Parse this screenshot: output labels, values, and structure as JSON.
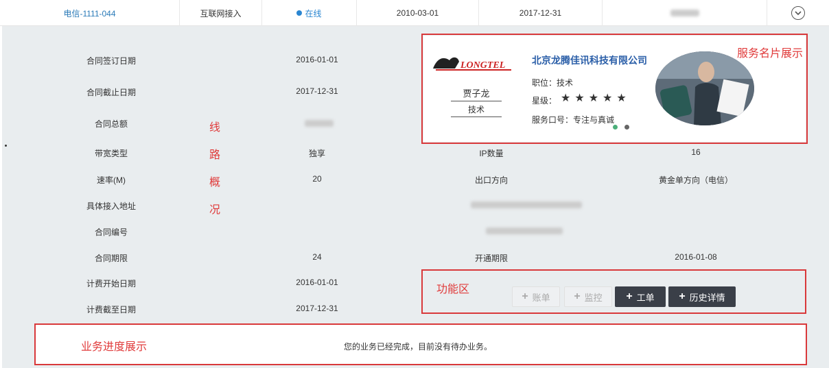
{
  "top_row": {
    "circuit_id": "电信-1111-044",
    "type": "互联网接入",
    "status": "在线",
    "start_date": "2010-03-01",
    "end_date": "2017-12-31"
  },
  "details": [
    {
      "label": "合同签订日期",
      "value": "2016-01-01"
    },
    {
      "label": "合同截止日期",
      "value": "2017-12-31"
    },
    {
      "label": "合同总额",
      "value": ""
    },
    {
      "label": "带宽类型",
      "value": "独享",
      "label2": "IP数量",
      "value2": "16"
    },
    {
      "label": "速率(M)",
      "value": "20",
      "label2": "出口方向",
      "value2": "黄金单方向（电信）"
    },
    {
      "label": "具体接入地址",
      "value": ""
    },
    {
      "label": "合同编号",
      "value": ""
    },
    {
      "label": "合同期限",
      "value": "24",
      "label2": "开通期限",
      "value2": "2016-01-08"
    },
    {
      "label": "计费开始日期",
      "value": "2016-01-01"
    },
    {
      "label": "计费截至日期",
      "value": "2017-12-31"
    }
  ],
  "annotations": {
    "line_overview": [
      "线",
      "路",
      "概",
      "况"
    ],
    "card_title": "服务名片展示",
    "function_area": "功能区",
    "progress_title": "业务进度展示"
  },
  "card": {
    "logo_text": "LONGTEL",
    "company": "北京龙腾佳讯科技有限公司",
    "name": "贾子龙",
    "role": "技术",
    "position": "职位：技术",
    "rating_label": "星级：",
    "rating": 5,
    "service_motto": "服务口号：专注与真诚",
    "dot_colors": [
      "#4caf7a",
      "#666666"
    ]
  },
  "buttons": {
    "bill": "账单",
    "monitor": "监控",
    "ticket": "工单",
    "history": "历史详情"
  },
  "progress_message": "您的业务已经完成，目前没有待办业务。",
  "colors": {
    "accent_red": "#d9383a",
    "link_blue": "#2a7ab8",
    "panel_bg": "#e9edef",
    "dark_button": "#3a3f48"
  }
}
